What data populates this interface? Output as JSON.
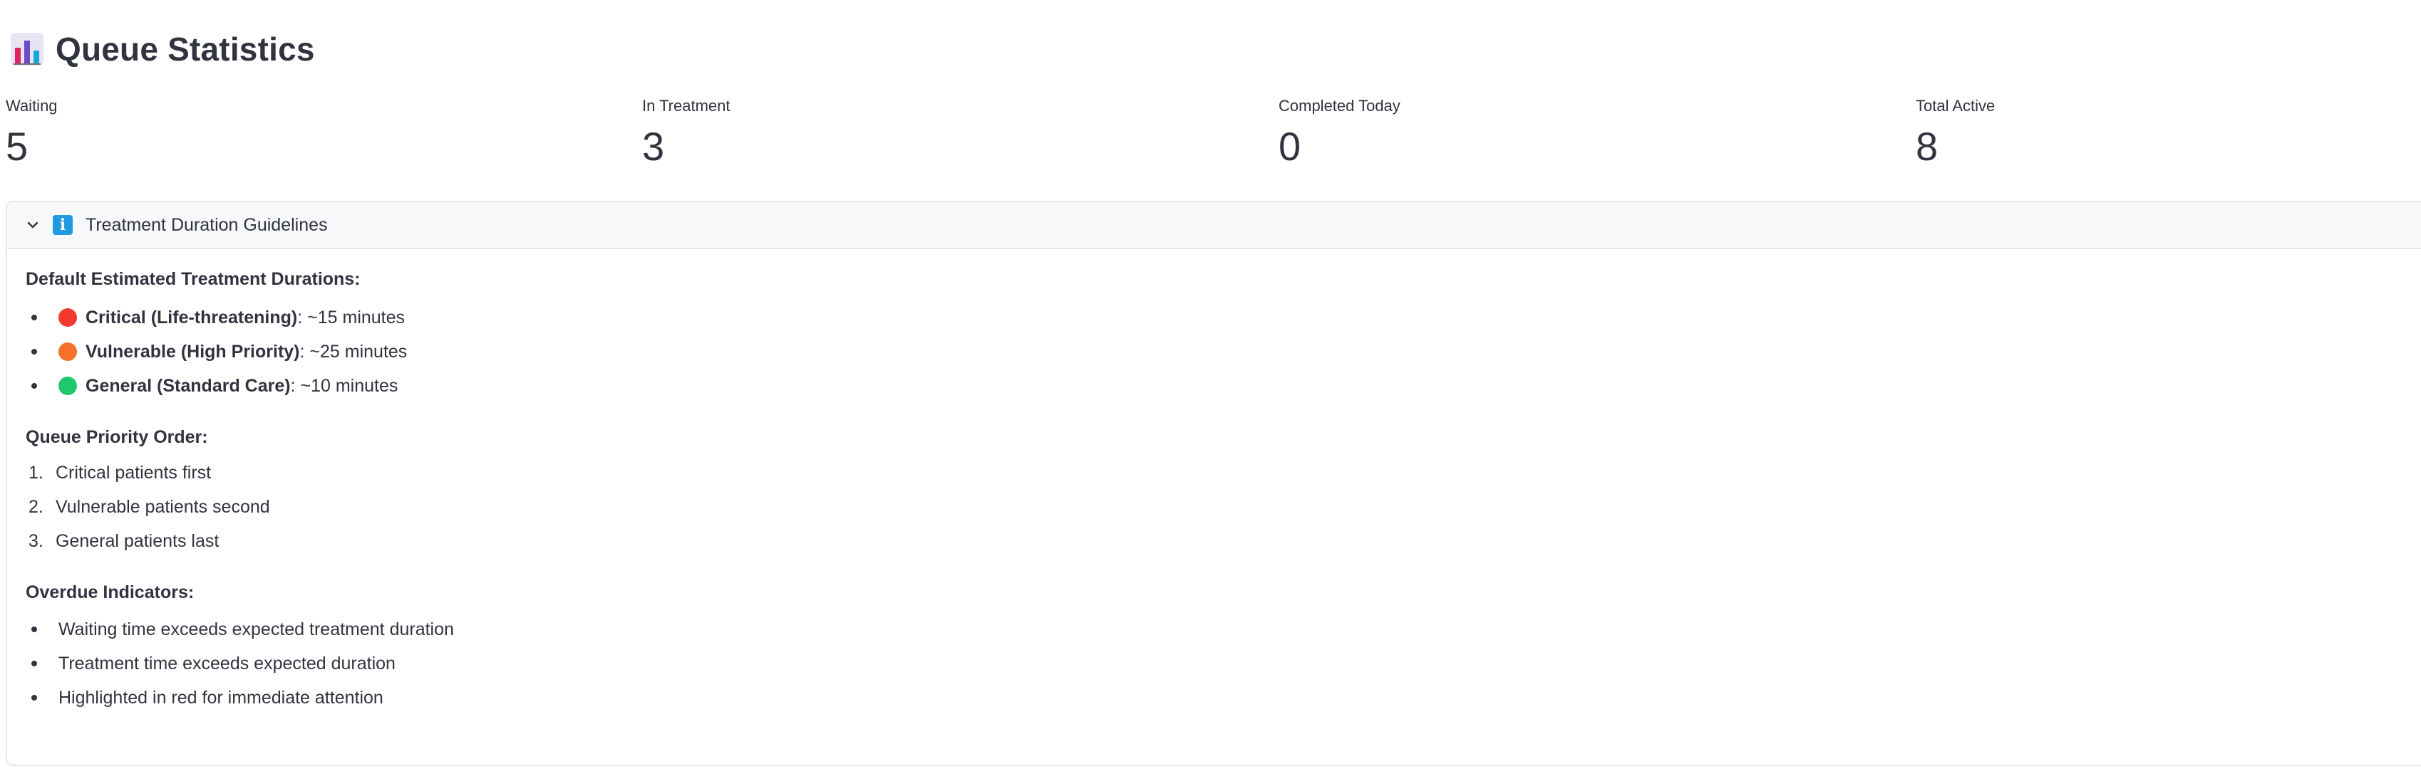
{
  "header": {
    "icon": "bar-chart-icon",
    "title": "Queue Statistics"
  },
  "metrics": [
    {
      "label": "Waiting",
      "value": "5"
    },
    {
      "label": "In Treatment",
      "value": "3"
    },
    {
      "label": "Completed Today",
      "value": "0"
    },
    {
      "label": "Total Active",
      "value": "8"
    }
  ],
  "expander": {
    "title": "Treatment Duration Guidelines",
    "icon": "information-icon",
    "expanded": true,
    "durations_heading": "Default Estimated Treatment Durations:",
    "durations": [
      {
        "label": "Critical (Life-threatening)",
        "value": ": ~15 minutes",
        "color": "#f23a2f"
      },
      {
        "label": "Vulnerable (High Priority)",
        "value": ": ~25 minutes",
        "color": "#f5712a"
      },
      {
        "label": "General (Standard Care)",
        "value": ": ~10 minutes",
        "color": "#1fc86a"
      }
    ],
    "priority_heading": "Queue Priority Order:",
    "priority": [
      {
        "num": "1.",
        "text": "Critical patients first"
      },
      {
        "num": "2.",
        "text": "Vulnerable patients second"
      },
      {
        "num": "3.",
        "text": "General patients last"
      }
    ],
    "overdue_heading": "Overdue Indicators:",
    "overdue": [
      "Waiting time exceeds expected treatment duration",
      "Treatment time exceeds expected duration",
      "Highlighted in red for immediate attention"
    ]
  }
}
